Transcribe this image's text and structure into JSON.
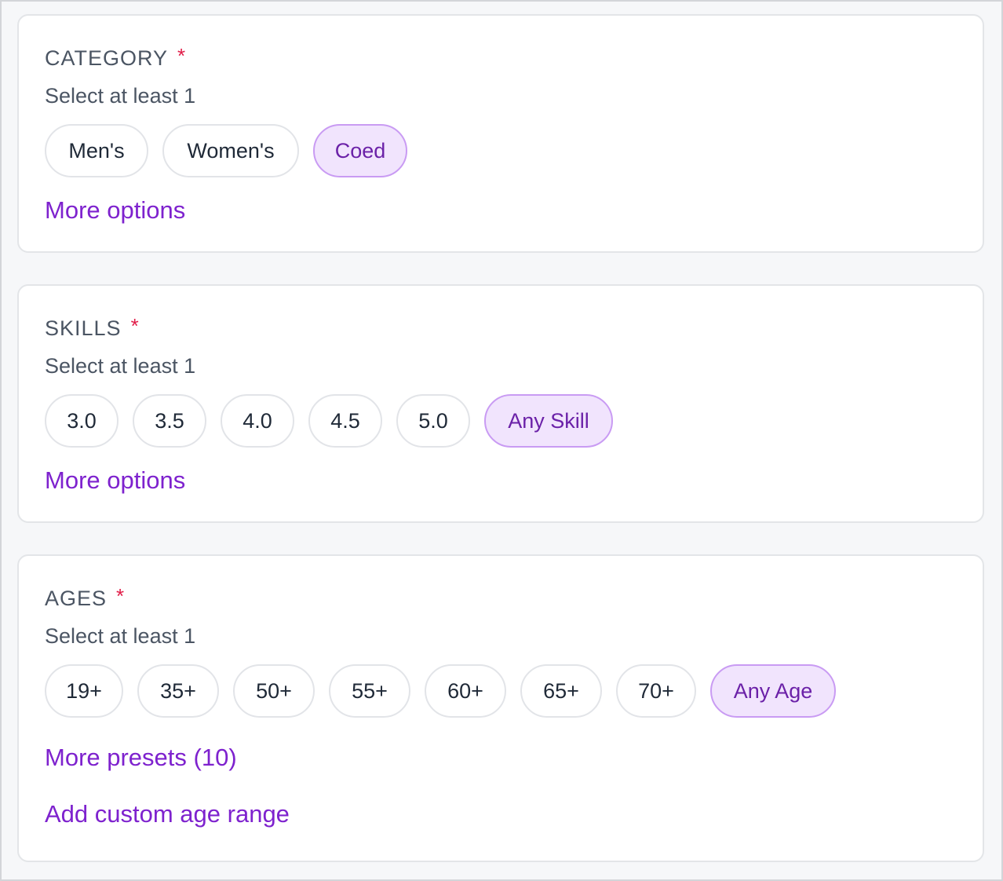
{
  "category": {
    "title": "CATEGORY",
    "required_mark": "*",
    "hint": "Select at least 1",
    "options": [
      {
        "label": "Men's",
        "selected": false
      },
      {
        "label": "Women's",
        "selected": false
      },
      {
        "label": "Coed",
        "selected": true
      }
    ],
    "more_link": "More options"
  },
  "skills": {
    "title": "SKILLS",
    "required_mark": "*",
    "hint": "Select at least 1",
    "options": [
      {
        "label": "3.0",
        "selected": false
      },
      {
        "label": "3.5",
        "selected": false
      },
      {
        "label": "4.0",
        "selected": false
      },
      {
        "label": "4.5",
        "selected": false
      },
      {
        "label": "5.0",
        "selected": false
      },
      {
        "label": "Any Skill",
        "selected": true
      }
    ],
    "more_link": "More options"
  },
  "ages": {
    "title": "AGES",
    "required_mark": "*",
    "hint": "Select at least 1",
    "options": [
      {
        "label": "19+",
        "selected": false
      },
      {
        "label": "35+",
        "selected": false
      },
      {
        "label": "50+",
        "selected": false
      },
      {
        "label": "55+",
        "selected": false
      },
      {
        "label": "60+",
        "selected": false
      },
      {
        "label": "65+",
        "selected": false
      },
      {
        "label": "70+",
        "selected": false
      },
      {
        "label": "Any Age",
        "selected": true
      }
    ],
    "more_presets_link": "More presets (10)",
    "custom_range_link": "Add custom age range"
  },
  "colors": {
    "accent": "#7e22ce",
    "selected_bg": "#f1e4fd",
    "selected_border": "#c99bf3",
    "required": "#e11d48",
    "muted_text": "#4b5563"
  }
}
